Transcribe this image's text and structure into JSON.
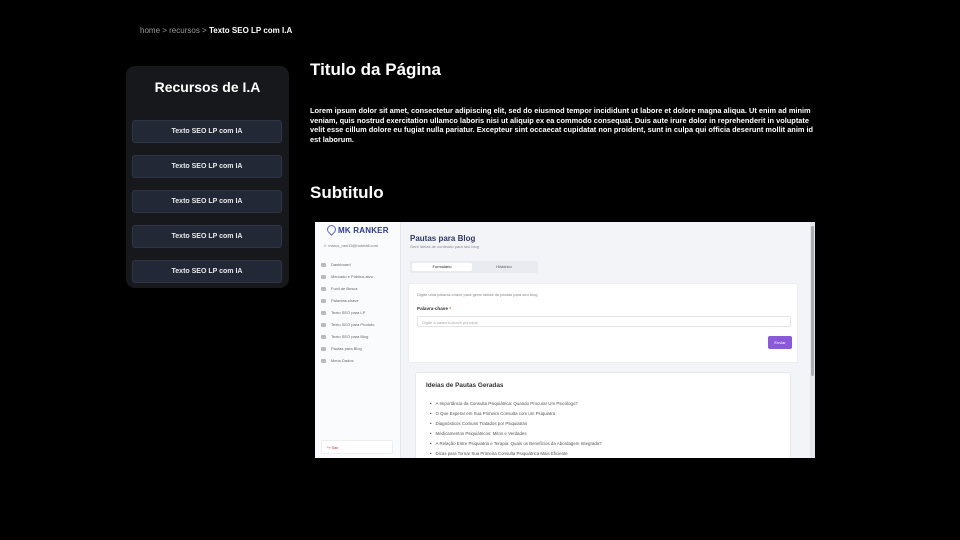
{
  "breadcrumb": {
    "home": "home",
    "sep1": " > ",
    "recursos": "recursos",
    "sep2": " > ",
    "current": "Texto SEO LP com I.A"
  },
  "sidebar": {
    "title": "Recursos de I.A",
    "items": [
      {
        "label": "Texto SEO LP com IA"
      },
      {
        "label": "Texto SEO LP com IA"
      },
      {
        "label": "Texto SEO LP com IA"
      },
      {
        "label": "Texto SEO LP com IA"
      },
      {
        "label": "Texto SEO LP com IA"
      }
    ]
  },
  "main": {
    "title": "Titulo da Página",
    "body": "Lorem ipsum dolor sit amet, consectetur adipiscing elit, sed do eiusmod tempor incididunt ut labore et dolore magna aliqua. Ut enim ad minim veniam, quis nostrud exercitation ullamco laboris nisi ut aliquip ex ea commodo consequat. Duis aute irure dolor in reprehenderit in voluptate velit esse cillum dolore eu fugiat nulla pariatur. Excepteur sint occaecat cupidatat non proident, sunt in culpa qui officia deserunt mollit anim id est laborum.",
    "subtitle": "Subtitulo"
  },
  "screenshot": {
    "logo": "MK RANKER",
    "user_email": "marco_raw15@hotmail.com",
    "menu": [
      {
        "label": "Dashboard",
        "icon": "grid-icon"
      },
      {
        "label": "Mercado e Público-alvo",
        "icon": "target-icon"
      },
      {
        "label": "Funil de Busca",
        "icon": "funnel-icon"
      },
      {
        "label": "Palavras-chave",
        "icon": "key-icon"
      },
      {
        "label": "Texto SEO para LP",
        "icon": "doc-icon"
      },
      {
        "label": "Texto SEO para Produto",
        "icon": "doc-icon"
      },
      {
        "label": "Texto SEO para Blog",
        "icon": "doc-icon"
      },
      {
        "label": "Pautas para Blog",
        "icon": "list-icon"
      },
      {
        "label": "Meus Dados",
        "icon": "user-icon"
      }
    ],
    "logout": "Sair",
    "page_title": "Pautas para Blog",
    "page_subtitle": "Gere ideias de conteúdo para seu blog",
    "tabs": [
      {
        "label": "Formulário",
        "active": true
      },
      {
        "label": "Histórico",
        "active": false
      }
    ],
    "form": {
      "hint": "Digite uma palavra-chave para gerar ideias de pautas para seu blog",
      "label": "Palavra-chave",
      "required_mark": "*",
      "placeholder": "Digite a palavra-chave principal",
      "submit": "Enviar"
    },
    "ideas": {
      "title": "Ideias de Pautas Geradas",
      "items": [
        "A Importância da Consulta Psiquiátrica: Quando Procurar Um Psicólogo?",
        "O Que Esperar em Sua Primeira Consulta com um Psiquiatra",
        "Diagnósticos Comuns Tratados por Psiquiatras",
        "Medicamentos Psiquiátricos: Mitos e Verdades",
        "A Relação Entre Psiquiatria e Terapia: Quais os Benefícios da Abordagem Integrada?",
        "Dicas para Tornar Sua Primeira Consulta Psiquiátrica Mais Eficiente"
      ]
    }
  }
}
